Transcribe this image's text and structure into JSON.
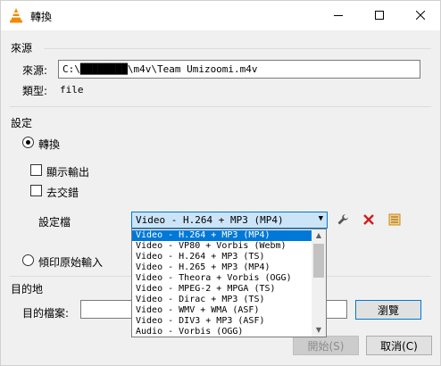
{
  "window": {
    "title": "轉換",
    "controls": {
      "minimize": "minimize-icon",
      "maximize": "maximize-icon",
      "close": "close-icon"
    }
  },
  "source": {
    "section_label": "來源",
    "source_label": "來源:",
    "source_value": "C:\\████████\\m4v\\Team  Umizoomi.m4v",
    "type_label": "類型:",
    "type_value": "file"
  },
  "settings": {
    "section_label": "設定",
    "convert_label": "轉換",
    "convert_checked": true,
    "show_output_label": "顯示輸出",
    "show_output_checked": false,
    "deinterlace_label": "去交錯",
    "deinterlace_checked": false,
    "profile_label": "設定檔",
    "profile_selected": "Video - H.264 + MP3 (MP4)",
    "profile_options": [
      "Video - H.264 + MP3 (MP4)",
      "Video - VP80 + Vorbis (Webm)",
      "Video - H.264 + MP3 (TS)",
      "Video - H.265 + MP3 (MP4)",
      "Video - Theora + Vorbis (OGG)",
      "Video - MPEG-2 + MPGA (TS)",
      "Video - Dirac + MP3 (TS)",
      "Video - WMV + WMA (ASF)",
      "Video - DIV3 + MP3 (ASF)",
      "Audio - Vorbis (OGG)"
    ],
    "dump_raw_label": "傾印原始輸入",
    "dump_raw_checked": false
  },
  "destination": {
    "section_label": "目的地",
    "file_label": "目的檔案:",
    "file_value": "",
    "browse_label": "瀏覽"
  },
  "footer": {
    "start_label": "開始(S)",
    "cancel_label": "取消(C)"
  },
  "colors": {
    "accent": "#0078d7",
    "selection": "#0078d7",
    "combo_bg": "#cce4f7",
    "vlc_orange": "#f08b00"
  }
}
